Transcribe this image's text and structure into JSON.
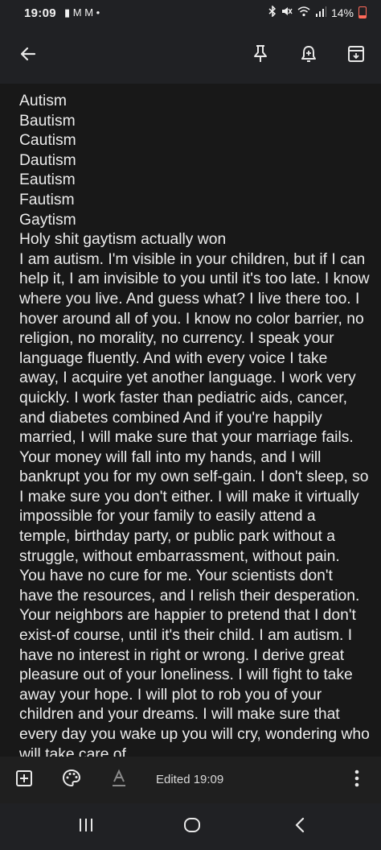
{
  "status_bar": {
    "time": "19:09",
    "left_icons": "▮ M M •",
    "battery_text": "14%"
  },
  "app_bar": {
    "back_icon": "arrow-left-icon",
    "pin_icon": "pin-icon",
    "reminder_icon": "bell-plus-icon",
    "archive_icon": "archive-icon"
  },
  "note": {
    "lines": [
      "Autism",
      "Bautism",
      "Cautism",
      "Dautism",
      "Eautism",
      "Fautism",
      "Gaytism",
      "Holy shit gaytism actually won"
    ],
    "body": "I am autism. I'm visible in your children, but if I can help it, I am invisible to you until it's too late. I know where you live. And guess what? I live there too. I hover around all of you. I know no color barrier, no religion, no morality, no currency. I speak your language fluently. And with every voice I take away, I acquire yet another language. I work very quickly. I work faster than pediatric aids, cancer, and diabetes combined And if you're happily married, I will make sure that your marriage fails. Your money will fall into my hands, and I will bankrupt you for my own self-gain. I don't sleep, so I make sure you don't either. I will make it virtually impossible for your family to easily attend a temple, birthday party, or public park without a struggle, without embarrassment, without pain. You have no cure for me. Your scientists don't have the resources, and I relish their desperation. Your neighbors are happier to pretend that I don't exist-of course, until it's their child. I am autism. I have no interest in right or wrong. I derive great pleasure out of your loneliness. I will fight to take away your hope. I will plot to rob you of your children and your dreams. I will make sure that every day you wake up you will cry, wondering who will take care of"
  },
  "bottom_toolbar": {
    "edited_label": "Edited 19:09",
    "add_icon": "plus-box-icon",
    "palette_icon": "palette-icon",
    "text_format_icon": "text-format-icon",
    "more_icon": "more-vert-icon"
  },
  "nav_bar": {
    "recents_icon": "recents-icon",
    "home_icon": "home-icon",
    "back_icon": "back-chevron-icon"
  }
}
